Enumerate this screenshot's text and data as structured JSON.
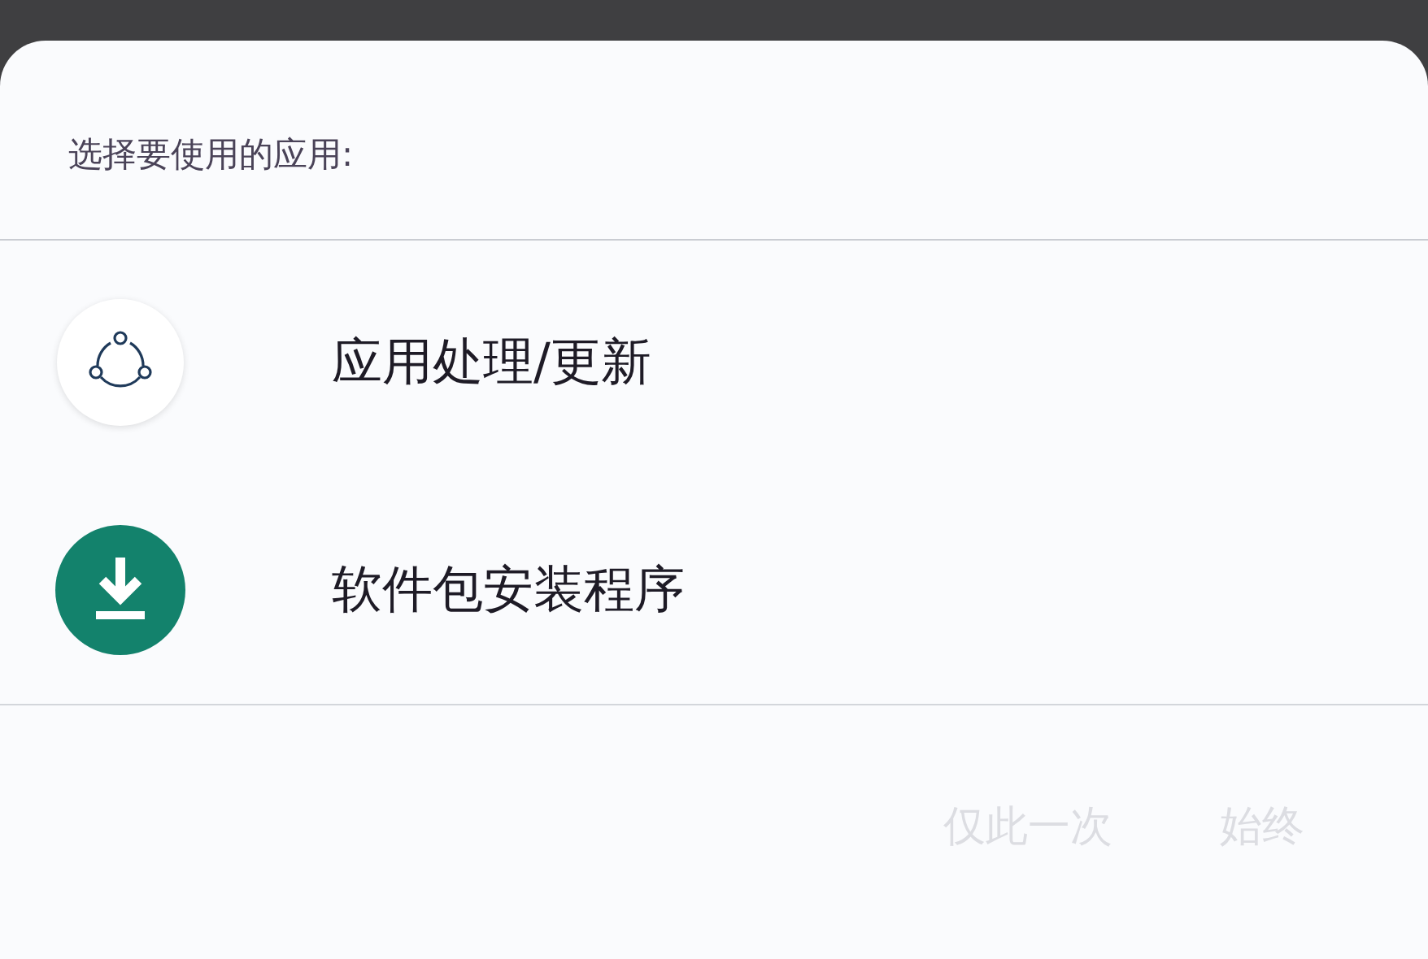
{
  "dialog": {
    "title": "选择要使用的应用:"
  },
  "apps": [
    {
      "kind": "share",
      "label": "应用处理/更新"
    },
    {
      "kind": "download",
      "label": "软件包安装程序"
    }
  ],
  "buttons": [
    {
      "label": "仅此一次",
      "disabled": true
    },
    {
      "label": "始终",
      "disabled": true
    }
  ]
}
